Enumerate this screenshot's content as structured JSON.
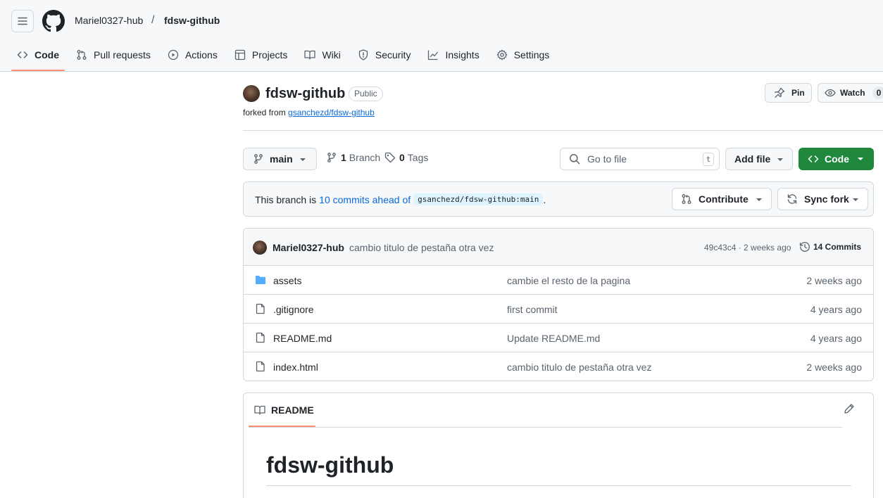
{
  "header": {
    "owner": "Mariel0327-hub",
    "separator": "/",
    "repo": "fdsw-github"
  },
  "nav": {
    "items": [
      {
        "label": "Code",
        "icon": "code-icon",
        "active": true
      },
      {
        "label": "Pull requests",
        "icon": "pull-request-icon"
      },
      {
        "label": "Actions",
        "icon": "play-icon"
      },
      {
        "label": "Projects",
        "icon": "table-icon"
      },
      {
        "label": "Wiki",
        "icon": "book-icon"
      },
      {
        "label": "Security",
        "icon": "shield-icon"
      },
      {
        "label": "Insights",
        "icon": "graph-icon"
      },
      {
        "label": "Settings",
        "icon": "gear-icon"
      }
    ]
  },
  "repo": {
    "title": "fdsw-github",
    "visibility": "Public",
    "forked_from_label": "forked from",
    "forked_from_link": "gsanchezd/fdsw-github",
    "pin_label": "Pin",
    "watch_label": "Watch",
    "watch_count": "0"
  },
  "toolbar": {
    "branch": "main",
    "branch_count": "1",
    "branch_label": "Branch",
    "tag_count": "0",
    "tag_label": "Tags",
    "goto_placeholder": "Go to file",
    "goto_shortcut": "t",
    "add_file_label": "Add file",
    "code_label": "Code"
  },
  "ahead": {
    "prefix": "This branch is",
    "link": "10 commits ahead of",
    "ref": "gsanchezd/fdsw-github:main",
    "suffix": ".",
    "contribute_label": "Contribute",
    "sync_label": "Sync fork"
  },
  "latest_commit": {
    "author": "Mariel0327-hub",
    "message": "cambio titulo de pestaña otra vez",
    "meta": "49c43c4 · 2 weeks ago",
    "commits_label": "14 Commits"
  },
  "files": [
    {
      "name": "assets",
      "type": "folder",
      "message": "cambie el resto de la pagina",
      "date": "2 weeks ago"
    },
    {
      "name": ".gitignore",
      "type": "file",
      "message": "first commit",
      "date": "4 years ago"
    },
    {
      "name": "README.md",
      "type": "file",
      "message": "Update README.md",
      "date": "4 years ago"
    },
    {
      "name": "index.html",
      "type": "file",
      "message": "cambio titulo de pestaña otra vez",
      "date": "2 weeks ago"
    }
  ],
  "readme": {
    "tab_label": "README",
    "heading": "fdsw-github"
  },
  "colors": {
    "accent_green": "#1f883d",
    "link_blue": "#0969da",
    "active_tab": "#fd8c73",
    "folder_blue": "#54aeff"
  }
}
